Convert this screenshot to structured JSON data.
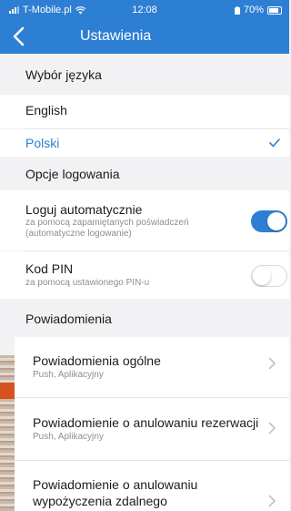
{
  "status_bar": {
    "carrier": "T-Mobile.pl",
    "time": "12:08",
    "battery": "70%"
  },
  "nav": {
    "title": "Ustawienia"
  },
  "language_section": {
    "header": "Wybór języka",
    "options": [
      {
        "label": "English",
        "selected": false
      },
      {
        "label": "Polski",
        "selected": true
      }
    ]
  },
  "login_section": {
    "header": "Opcje logowania",
    "auto_login": {
      "label": "Loguj automatycznie",
      "subtitle_line1": "za pomocą zapamiętanych poświadczeń",
      "subtitle_line2": "(automatyczne logowanie)",
      "enabled": true
    },
    "pin": {
      "label": "Kod PIN",
      "subtitle": "za pomocą ustawionego PIN-u",
      "enabled": false
    }
  },
  "notifications_section": {
    "header": "Powiadomienia",
    "items": [
      {
        "title_line1": "Powiadomienia ogólne",
        "title_line2": "",
        "subtitle": "Push, Aplikacyjny"
      },
      {
        "title_line1": "Powiadomienie o anulowaniu rezerwacji",
        "title_line2": "",
        "subtitle": "Push, Aplikacyjny"
      },
      {
        "title_line1": "Powiadomienie o anulowaniu",
        "title_line2": "wypożyczenia zdalnego",
        "subtitle": ""
      }
    ]
  },
  "colors": {
    "accent": "#2d7fd3",
    "background": "#f2f2f4",
    "secondary_text": "#8e8e93"
  }
}
